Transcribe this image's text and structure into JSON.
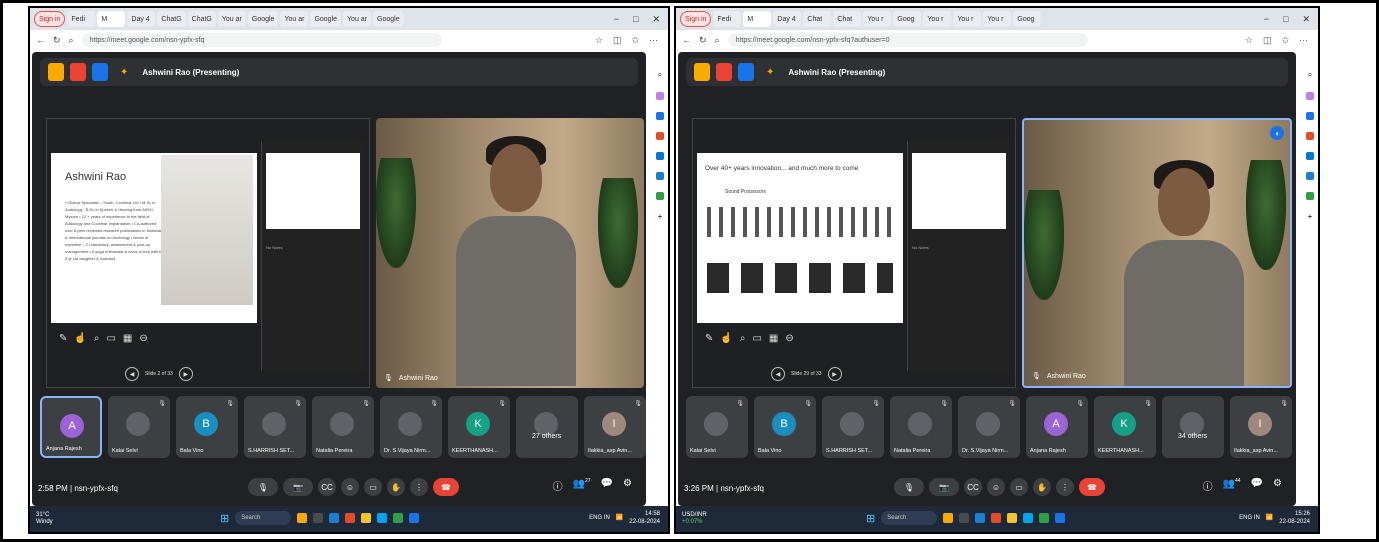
{
  "left": {
    "tabs": [
      "Sign in",
      "Fedi",
      "M",
      "Day 4",
      "ChatG",
      "ChatG",
      "You ar",
      "Google",
      "You ar",
      "Google",
      "You ar",
      "Google"
    ],
    "url": "https://meet.google.com/nsn-ypfx-sfq",
    "presenting": "Ashwini Rao (Presenting)",
    "slide_title": "Ashwini Rao",
    "slide_bullets": "• Clinical Specialist – South, Cochlear Ltd • M.Sc in Audiology , B.Sc in Speech & Hearing from AIISH, Mysore • 12 + years of experience in the field of Audiology and Cochlear Implantation • Co-authored over 8 peer reviewed research publications in National & International journals on Audiology • Areas of expertise – CI candidacy, assessment & post-op management • A yoga enthusiast & loves to trek with her 5 yr old daughter & husband",
    "notes_label": "No Notes",
    "slide_counter": "Slide 2 of 33",
    "speaker_name": "Ashwini Rao",
    "participants": [
      {
        "name": "Anjana Rajesh",
        "initial": "A",
        "color": "#9c63d6"
      },
      {
        "name": "Kalai Selvi",
        "initial": "",
        "color": "#5f6368"
      },
      {
        "name": "Bala Vino",
        "initial": "B",
        "color": "#1a8fbf"
      },
      {
        "name": "S.HARRISH SET...",
        "initial": "",
        "color": "#5f6368"
      },
      {
        "name": "Natalia Pereira",
        "initial": "",
        "color": "#5f6368"
      },
      {
        "name": "Dr. S.Vijaya Nirm...",
        "initial": "",
        "color": "#5f6368"
      },
      {
        "name": "KEERTHANASH...",
        "initial": "K",
        "color": "#16a085"
      },
      {
        "name": "27 others",
        "initial": "",
        "color": "#5f6368"
      },
      {
        "name": "Ilakkia_asp Avin...",
        "initial": "I",
        "color": "#a1887f"
      }
    ],
    "time_meeting": "2:58 PM | nsn-ypfx-sfq",
    "badge_count": "27",
    "weather_temp": "31°C",
    "weather_desc": "Windy",
    "search_label": "Search",
    "tray_lang": "ENG IN",
    "tray_time": "14:58",
    "tray_date": "22-08-2024"
  },
  "right": {
    "tabs": [
      "Sign in",
      "Fedi",
      "M",
      "Day 4",
      "Chat",
      "Chat",
      "You r",
      "Goog",
      "You r",
      "You r",
      "You r",
      "Goog"
    ],
    "url": "https://meet.google.com/nsn-ypfx-sfq?authuser=0",
    "presenting": "Ashwini Rao (Presenting)",
    "slide_title": "Over 40+ years innovation... and much more to come",
    "slide_sub": "Sound Processors",
    "notes_label": "No Notes",
    "slide_counter": "Slide 29 of 33",
    "speaker_name": "Ashwini Rao",
    "participants": [
      {
        "name": "Kalai Selvi",
        "initial": "",
        "color": "#5f6368"
      },
      {
        "name": "Bala Vino",
        "initial": "B",
        "color": "#1a8fbf"
      },
      {
        "name": "S.HARRISH SET...",
        "initial": "",
        "color": "#5f6368"
      },
      {
        "name": "Natalia Pereira",
        "initial": "",
        "color": "#5f6368"
      },
      {
        "name": "Dr. S.Vijaya Nirm...",
        "initial": "",
        "color": "#5f6368"
      },
      {
        "name": "Anjana Rajesh",
        "initial": "A",
        "color": "#9c63d6"
      },
      {
        "name": "KEERTHANASH...",
        "initial": "K",
        "color": "#16a085"
      },
      {
        "name": "34 others",
        "initial": "",
        "color": "#5f6368"
      },
      {
        "name": "Ilakkia_asp Avin...",
        "initial": "I",
        "color": "#a1887f"
      }
    ],
    "time_meeting": "3:26 PM | nsn-ypfx-sfq",
    "badge_count": "44",
    "weather_temp": "USD/INR",
    "weather_desc": "+0.07%",
    "search_label": "Search",
    "tray_lang": "ENG IN",
    "tray_time": "15:26",
    "tray_date": "22-08-2024"
  }
}
